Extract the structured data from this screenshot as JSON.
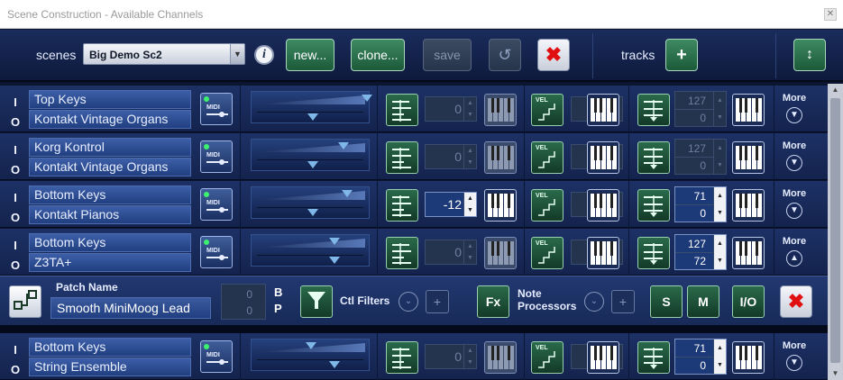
{
  "window": {
    "title": "Scene Construction - Available Channels"
  },
  "toolbar": {
    "scenes_label": "scenes",
    "scene_value": "Big Demo Sc2",
    "new_label": "new...",
    "clone_label": "clone...",
    "save_label": "save",
    "tracks_label": "tracks"
  },
  "channels": [
    {
      "io_in": "I",
      "io_out": "O",
      "keyboard": "Top Keys",
      "instrument": "Kontakt Vintage Organs",
      "midi_label": "MIDI",
      "transpose": "0",
      "velocity": "0",
      "range_high": "127",
      "range_low": "0",
      "more_label": "More"
    },
    {
      "io_in": "I",
      "io_out": "O",
      "keyboard": "Korg Kontrol",
      "instrument": "Kontakt Vintage Organs",
      "midi_label": "MIDI",
      "transpose": "0",
      "velocity": "0",
      "range_high": "127",
      "range_low": "0",
      "more_label": "More"
    },
    {
      "io_in": "I",
      "io_out": "O",
      "keyboard": "Bottom Keys",
      "instrument": "Kontakt Pianos",
      "midi_label": "MIDI",
      "transpose": "-12",
      "velocity": "0",
      "range_high": "71",
      "range_low": "0",
      "more_label": "More"
    },
    {
      "io_in": "I",
      "io_out": "O",
      "keyboard": "Bottom Keys",
      "instrument": "Z3TA+",
      "midi_label": "MIDI",
      "transpose": "0",
      "velocity": "0",
      "range_high": "127",
      "range_low": "72",
      "more_label": "More"
    },
    {
      "io_in": "I",
      "io_out": "O",
      "keyboard": "Bottom Keys",
      "instrument": "String Ensemble",
      "midi_label": "MIDI",
      "transpose": "0",
      "velocity": "0",
      "range_high": "71",
      "range_low": "0",
      "more_label": "More"
    }
  ],
  "patch_panel": {
    "patch_name_label": "Patch Name",
    "patch_name": "Smooth MiniMoog Lead",
    "bank_value": "0",
    "program_value": "0",
    "b_label": "B",
    "p_label": "P",
    "ctl_filters_label": "Ctl Filters",
    "fx_label": "Fx",
    "note_label": "Note",
    "processors_label": "Processors",
    "solo_label": "S",
    "mute_label": "M",
    "io_label": "I/O"
  },
  "filter_labels": {
    "vel": "VEL"
  },
  "colors": {
    "accent_green": "#2a6a4a",
    "panel_blue": "#1d3166",
    "delete_red": "#e01010"
  }
}
